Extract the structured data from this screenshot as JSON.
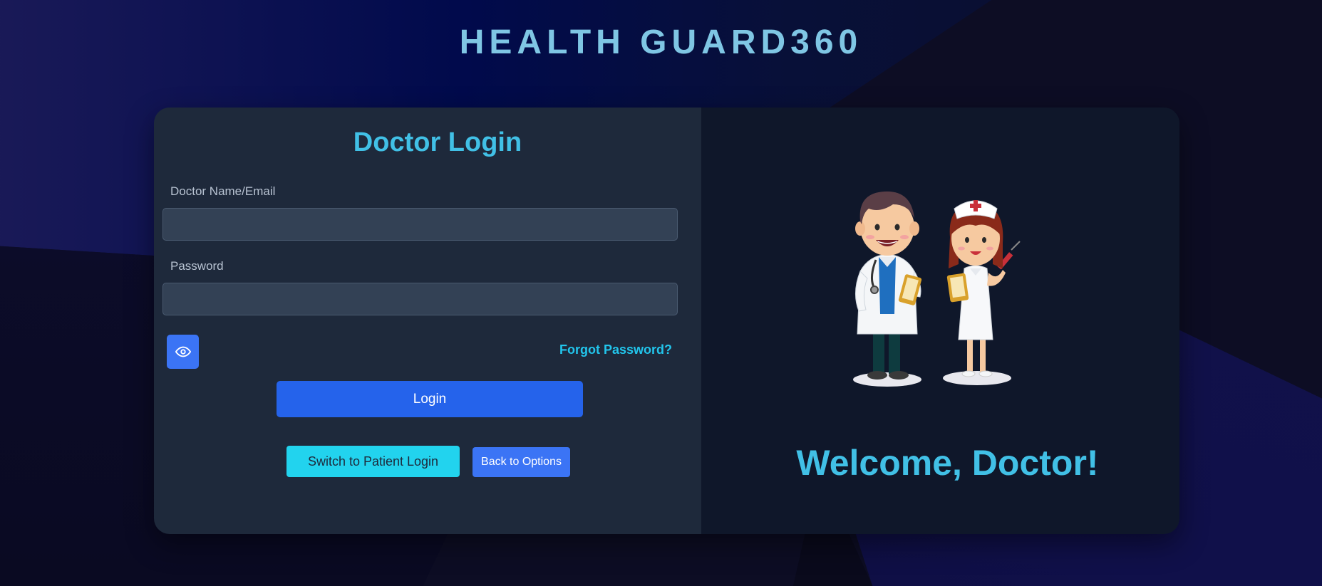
{
  "app": {
    "title": "HEALTH GUARD360"
  },
  "login": {
    "heading": "Doctor Login",
    "name_label": "Doctor Name/Email",
    "name_value": "",
    "password_label": "Password",
    "password_value": "",
    "toggle_password_icon": "eye-icon",
    "forgot_link": "Forgot Password?",
    "login_button": "Login",
    "switch_button": "Switch to Patient Login",
    "back_button": "Back to Options"
  },
  "welcome": {
    "illustration": "doctor-and-nurse-illustration",
    "text": "Welcome, Doctor!"
  },
  "colors": {
    "accent": "#41c0e6",
    "primary_button": "#2563eb",
    "secondary_button": "#3b74f5",
    "cyan_button": "#22d3ee",
    "card_left": "#1e293b",
    "card_right": "#0f172a"
  }
}
